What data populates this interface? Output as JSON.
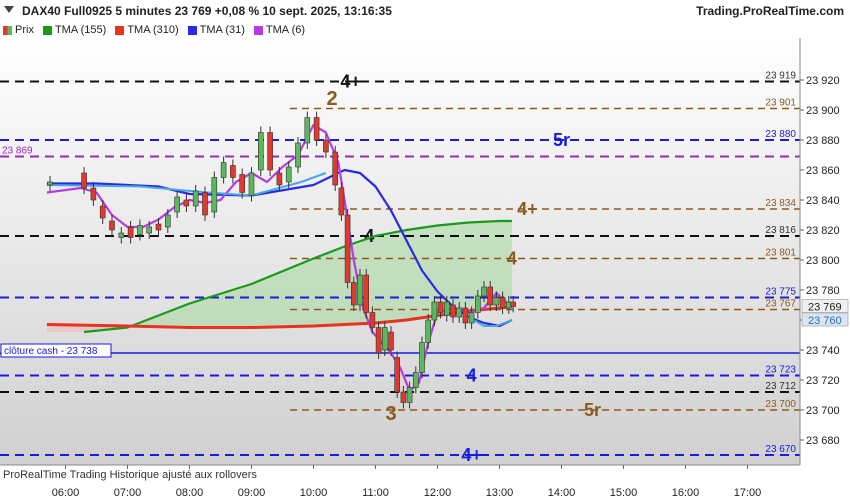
{
  "header": {
    "title": "DAX40 Full0925 5 minutes 23 769 +0,08 % 10 sept. 2025, 13:16:35",
    "site": "Trading.ProRealTime.com"
  },
  "legend": [
    {
      "label": "Prix",
      "color": "#5cb85c",
      "style": "candle"
    },
    {
      "label": "TMA (155)",
      "color": "#1a9a1a"
    },
    {
      "label": "TMA (310)",
      "color": "#e8331e"
    },
    {
      "label": "TMA (31)",
      "color": "#2a2ae0"
    },
    {
      "label": "TMA (6)",
      "color": "#b43ce0"
    }
  ],
  "footer": "ProRealTime Trading  Historique ajusté aux rollovers",
  "cash_label": "clôture cash -  23 738",
  "left_level_label": "23 869",
  "price_tags": [
    {
      "text": "23 769",
      "bg": "#f0f0f0",
      "color": "#222"
    },
    {
      "text": "23 760",
      "bg": "#d9e6f2",
      "color": "#2a6fb0"
    }
  ],
  "chart_data": {
    "type": "line",
    "title": "DAX40 Full0925 5 minutes",
    "ylim": [
      23655,
      23935
    ],
    "x_ticks": [
      "06:00",
      "07:00",
      "08:00",
      "09:00",
      "10:00",
      "11:00",
      "12:00",
      "13:00",
      "14:00",
      "15:00",
      "16:00",
      "17:00"
    ],
    "y_ticks": [
      23660,
      23680,
      23700,
      23720,
      23740,
      23760,
      23780,
      23800,
      23820,
      23840,
      23860,
      23880,
      23900,
      23920
    ],
    "y_tick_labels": [
      "23 660",
      "23 680",
      "23 700",
      "23 720",
      "23 740",
      "23 760",
      "23 780",
      "23 800",
      "23 820",
      "23 840",
      "23 860",
      "23 880",
      "23 900",
      "23 920"
    ],
    "levels": [
      {
        "value": 23919,
        "label": "23 919",
        "color": "#111111",
        "tag": "4+",
        "tag_color": "#111111",
        "tag_hour": 10.6
      },
      {
        "value": 23901,
        "label": "23 901",
        "color": "#8b5a1e",
        "tag": "",
        "tag_color": "#8b5a1e"
      },
      {
        "value": 23880,
        "label": "23 880",
        "color": "#1a1ae0",
        "tag": "5r",
        "tag_color": "#1a1ae0",
        "tag_hour": 14.0
      },
      {
        "value": 23869,
        "label": "",
        "color": "#9a2ab8",
        "tag": "",
        "tag_color": "#9a2ab8"
      },
      {
        "value": 23834,
        "label": "23 834",
        "color": "#8b5a1e",
        "tag": "4+",
        "tag_color": "#8b5a1e",
        "tag_hour": 13.45
      },
      {
        "value": 23816,
        "label": "23 816",
        "color": "#111111",
        "tag": "4",
        "tag_color": "#111111",
        "tag_hour": 10.9
      },
      {
        "value": 23801,
        "label": "23 801",
        "color": "#8b5a1e",
        "tag": "4",
        "tag_color": "#8b5a1e",
        "tag_hour": 13.2
      },
      {
        "value": 23775,
        "label": "23 775",
        "color": "#1a1ae0",
        "tag": "",
        "tag_color": "#1a1ae0"
      },
      {
        "value": 23767,
        "label": "23 767",
        "color": "#8b5a1e",
        "tag": "",
        "tag_color": "#8b5a1e"
      },
      {
        "value": 23723,
        "label": "23 723",
        "color": "#1a1ae0",
        "tag": "4",
        "tag_color": "#1a1ae0",
        "tag_hour": 12.55
      },
      {
        "value": 23712,
        "label": "23 712",
        "color": "#111111",
        "tag": "",
        "tag_color": "#111111"
      },
      {
        "value": 23700,
        "label": "23 700",
        "color": "#8b5a1e",
        "tag": "5r",
        "tag_color": "#8b5a1e",
        "tag_hour": 14.5
      },
      {
        "value": 23670,
        "label": "23 670",
        "color": "#1a1ae0",
        "tag": "4+",
        "tag_color": "#1a1ae0",
        "tag_hour": 12.55
      }
    ],
    "annotations": [
      {
        "text": "2",
        "hour": 10.3,
        "y": 23908,
        "color": "#8b5a1e"
      },
      {
        "text": "3",
        "hour": 11.25,
        "y": 23698,
        "color": "#8b5a1e"
      }
    ],
    "cash_close": 23738,
    "series": [
      {
        "name": "TMA (155)",
        "color": "#1a9a1a",
        "x": [
          6.3,
          7.0,
          8.0,
          9.0,
          10.0,
          10.5,
          11.0,
          11.5,
          12.0,
          12.5,
          13.0,
          13.2
        ],
        "y": [
          23752,
          23755,
          23771,
          23784,
          23801,
          23809,
          23816,
          23820,
          23823,
          23825,
          23826,
          23826
        ]
      },
      {
        "name": "TMA (310)",
        "color": "#e8331e",
        "x": [
          5.7,
          7.0,
          8.0,
          9.0,
          10.0,
          11.0,
          11.5,
          12.0,
          12.5,
          13.0,
          13.2
        ],
        "y": [
          23757,
          23756,
          23755,
          23755,
          23756,
          23758,
          23760,
          23763,
          23766,
          23768,
          23769
        ]
      },
      {
        "name": "TMA (31)",
        "color": "#2a2ae0",
        "x": [
          5.7,
          6.5,
          7.5,
          8.0,
          9.0,
          10.0,
          10.5,
          10.75,
          11.0,
          11.25,
          11.5,
          11.75,
          12.0,
          12.25,
          12.5,
          12.75,
          13.0,
          13.2
        ],
        "y": [
          23851,
          23851,
          23849,
          23844,
          23843,
          23850,
          23860,
          23858,
          23849,
          23833,
          23813,
          23793,
          23779,
          23769,
          23762,
          23758,
          23756,
          23760
        ]
      },
      {
        "name": "TMA (6)",
        "color": "#b43ce0",
        "x": [
          5.7,
          6.25,
          6.5,
          6.75,
          7.0,
          7.25,
          7.5,
          7.75,
          8.0,
          8.25,
          8.5,
          8.75,
          9.0,
          9.25,
          9.5,
          9.75,
          10.0,
          10.2,
          10.4,
          10.5,
          10.65,
          10.8,
          10.95,
          11.1,
          11.25,
          11.4,
          11.55,
          11.7,
          11.85,
          12.0,
          12.25,
          12.5,
          12.75,
          12.95,
          13.1,
          13.2
        ],
        "y": [
          23845,
          23848,
          23845,
          23830,
          23822,
          23822,
          23827,
          23835,
          23840,
          23838,
          23840,
          23852,
          23858,
          23852,
          23862,
          23870,
          23890,
          23885,
          23865,
          23840,
          23800,
          23768,
          23752,
          23745,
          23738,
          23728,
          23713,
          23718,
          23745,
          23765,
          23768,
          23765,
          23768,
          23778,
          23772,
          23769
        ]
      }
    ],
    "candles": [
      {
        "x": 5.75,
        "o": 23850,
        "c": 23852
      },
      {
        "x": 6.3,
        "o": 23858,
        "c": 23848
      },
      {
        "x": 6.45,
        "o": 23848,
        "c": 23840
      },
      {
        "x": 6.6,
        "o": 23836,
        "c": 23828
      },
      {
        "x": 6.75,
        "o": 23826,
        "c": 23820
      },
      {
        "x": 6.9,
        "o": 23815,
        "c": 23818
      },
      {
        "x": 7.05,
        "o": 23822,
        "c": 23815
      },
      {
        "x": 7.2,
        "o": 23817,
        "c": 23823
      },
      {
        "x": 7.35,
        "o": 23818,
        "c": 23822
      },
      {
        "x": 7.5,
        "o": 23824,
        "c": 23820
      },
      {
        "x": 7.65,
        "o": 23822,
        "c": 23830
      },
      {
        "x": 7.8,
        "o": 23832,
        "c": 23842
      },
      {
        "x": 7.95,
        "o": 23840,
        "c": 23836
      },
      {
        "x": 8.1,
        "o": 23836,
        "c": 23846
      },
      {
        "x": 8.25,
        "o": 23845,
        "c": 23830
      },
      {
        "x": 8.4,
        "o": 23832,
        "c": 23855
      },
      {
        "x": 8.55,
        "o": 23855,
        "c": 23865
      },
      {
        "x": 8.7,
        "o": 23863,
        "c": 23855
      },
      {
        "x": 8.85,
        "o": 23857,
        "c": 23845
      },
      {
        "x": 9.0,
        "o": 23843,
        "c": 23858
      },
      {
        "x": 9.15,
        "o": 23860,
        "c": 23885
      },
      {
        "x": 9.3,
        "o": 23885,
        "c": 23860
      },
      {
        "x": 9.45,
        "o": 23858,
        "c": 23850
      },
      {
        "x": 9.6,
        "o": 23852,
        "c": 23862
      },
      {
        "x": 9.75,
        "o": 23862,
        "c": 23878
      },
      {
        "x": 9.9,
        "o": 23878,
        "c": 23895
      },
      {
        "x": 10.05,
        "o": 23895,
        "c": 23880
      },
      {
        "x": 10.2,
        "o": 23880,
        "c": 23872
      },
      {
        "x": 10.35,
        "o": 23872,
        "c": 23850
      },
      {
        "x": 10.45,
        "o": 23848,
        "c": 23830
      },
      {
        "x": 10.55,
        "o": 23830,
        "c": 23785
      },
      {
        "x": 10.65,
        "o": 23785,
        "c": 23770
      },
      {
        "x": 10.75,
        "o": 23770,
        "c": 23790
      },
      {
        "x": 10.85,
        "o": 23790,
        "c": 23765
      },
      {
        "x": 10.95,
        "o": 23765,
        "c": 23755
      },
      {
        "x": 11.05,
        "o": 23755,
        "c": 23738
      },
      {
        "x": 11.15,
        "o": 23740,
        "c": 23755
      },
      {
        "x": 11.25,
        "o": 23752,
        "c": 23740
      },
      {
        "x": 11.35,
        "o": 23735,
        "c": 23712
      },
      {
        "x": 11.45,
        "o": 23712,
        "c": 23705
      },
      {
        "x": 11.55,
        "o": 23705,
        "c": 23715
      },
      {
        "x": 11.65,
        "o": 23715,
        "c": 23725
      },
      {
        "x": 11.75,
        "o": 23725,
        "c": 23745
      },
      {
        "x": 11.85,
        "o": 23745,
        "c": 23760
      },
      {
        "x": 11.95,
        "o": 23760,
        "c": 23772
      },
      {
        "x": 12.05,
        "o": 23772,
        "c": 23765
      },
      {
        "x": 12.15,
        "o": 23763,
        "c": 23772
      },
      {
        "x": 12.25,
        "o": 23770,
        "c": 23762
      },
      {
        "x": 12.35,
        "o": 23762,
        "c": 23768
      },
      {
        "x": 12.45,
        "o": 23768,
        "c": 23758
      },
      {
        "x": 12.55,
        "o": 23758,
        "c": 23765
      },
      {
        "x": 12.65,
        "o": 23765,
        "c": 23776
      },
      {
        "x": 12.75,
        "o": 23776,
        "c": 23782
      },
      {
        "x": 12.85,
        "o": 23782,
        "c": 23770
      },
      {
        "x": 12.95,
        "o": 23770,
        "c": 23775
      },
      {
        "x": 13.05,
        "o": 23775,
        "c": 23768
      },
      {
        "x": 13.15,
        "o": 23768,
        "c": 23772
      },
      {
        "x": 13.22,
        "o": 23772,
        "c": 23769
      }
    ]
  }
}
